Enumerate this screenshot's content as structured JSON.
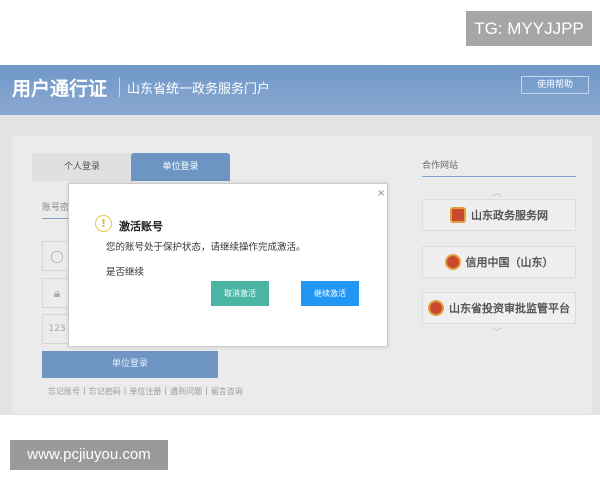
{
  "watermark_top": "TG: MYYJJPP",
  "watermark_bottom": "www.pcjiuyou.com",
  "header": {
    "brand": "用户通行证",
    "portal": "山东省统一政务服务门户",
    "help": "使用帮助"
  },
  "login": {
    "tabs": [
      {
        "label": "个人登录"
      },
      {
        "label": "单位登录"
      }
    ],
    "sub_tab": "账号密",
    "field_icons": [
      "user-icon",
      "lock-icon",
      "captcha-icon"
    ],
    "captcha_glyph": "123",
    "submit": "单位登录",
    "links": [
      "忘记账号",
      "忘记密码",
      "单位注册",
      "遇到问题",
      "留言咨询"
    ]
  },
  "partners": {
    "title": "合作网站",
    "items": [
      {
        "name": "山东政务服务网"
      },
      {
        "name": "信用中国（山东）"
      },
      {
        "name": "山东省投资审批监管平台"
      }
    ]
  },
  "dialog": {
    "close": "×",
    "icon": "!",
    "title": "激活账号",
    "message": "您的账号处于保护状态，请继续操作完成激活。",
    "question": "是否继续",
    "cancel": "取消激活",
    "confirm": "继续激活"
  },
  "colors": {
    "banner": "#6f97c9",
    "cancel": "#4bb5a4",
    "confirm": "#2196f3"
  }
}
